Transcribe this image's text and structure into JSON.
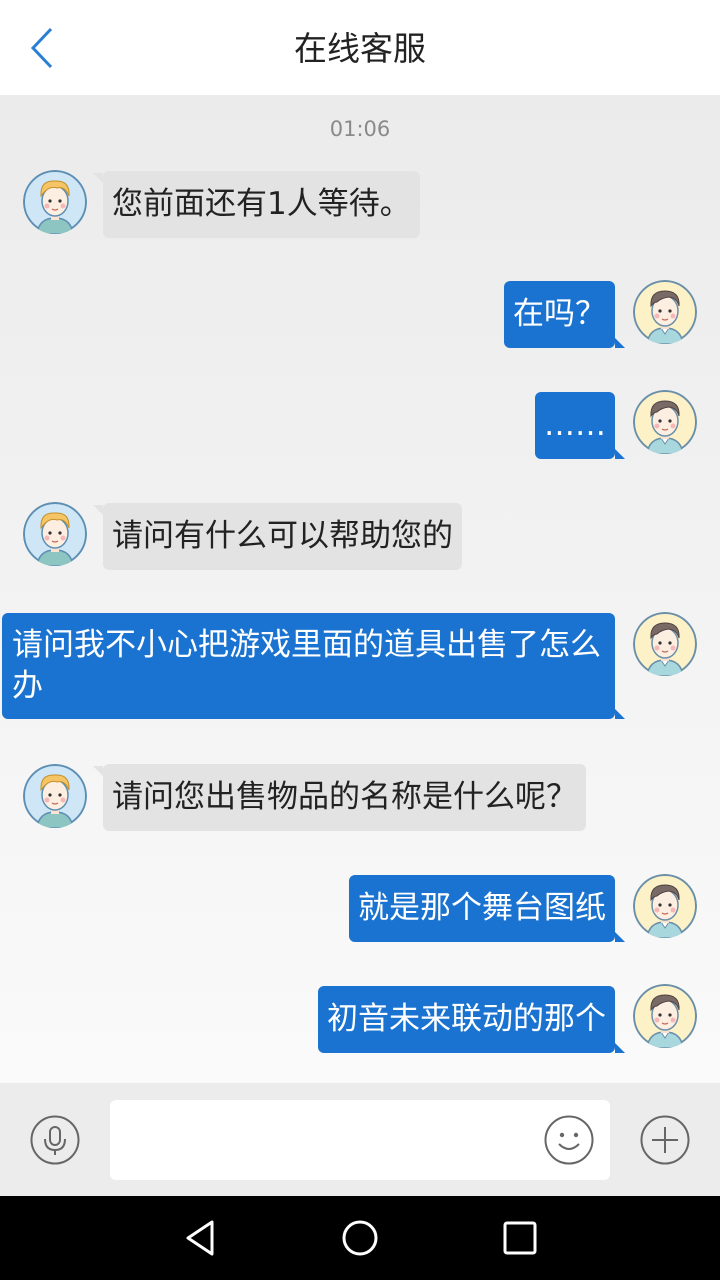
{
  "header": {
    "title": "在线客服",
    "back_icon": "chevron-left-icon",
    "accent_color": "#2a7fd4"
  },
  "chat": {
    "timestamp": "01:06",
    "user_bubble_color": "#1a73d0",
    "agent_bubble_color": "#e3e3e3",
    "messages": [
      {
        "sender": "agent",
        "text": "您前面还有1人等待。"
      },
      {
        "sender": "user",
        "text": "在吗？"
      },
      {
        "sender": "user",
        "text": "……"
      },
      {
        "sender": "agent",
        "text": "请问有什么可以帮助您的"
      },
      {
        "sender": "user",
        "text": "请问我不小心把游戏里面的道具出售了怎么办"
      },
      {
        "sender": "agent",
        "text": "请问您出售物品的名称是什么呢？"
      },
      {
        "sender": "user",
        "text": "就是那个舞台图纸"
      },
      {
        "sender": "user",
        "text": "初音未来联动的那个"
      }
    ]
  },
  "input_bar": {
    "message_value": "",
    "voice_icon": "microphone-icon",
    "emoji_icon": "smiley-icon",
    "more_icon": "plus-icon"
  },
  "system_nav": {
    "back_icon": "triangle-back-icon",
    "home_icon": "circle-home-icon",
    "recents_icon": "square-recents-icon"
  }
}
